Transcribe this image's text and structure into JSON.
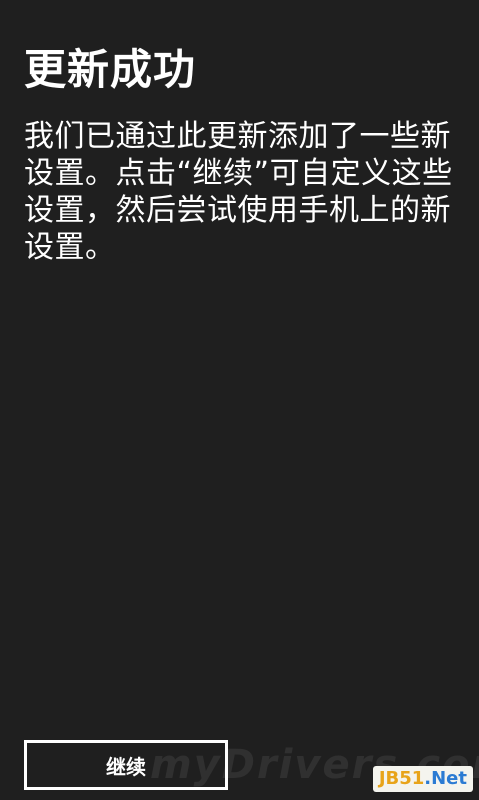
{
  "screen": {
    "title": "更新成功",
    "message": "我们已通过此更新添加了一些新设置。点击“继续”可自定义这些设置，然后尝试使用手机上的新设置。",
    "continue_label": "继续"
  },
  "watermark": {
    "text": "myDrivers.com",
    "badge_part_a": "JB51",
    "badge_part_b": ".Net"
  },
  "colors": {
    "background": "#1f1f1f",
    "foreground": "#ffffff"
  }
}
